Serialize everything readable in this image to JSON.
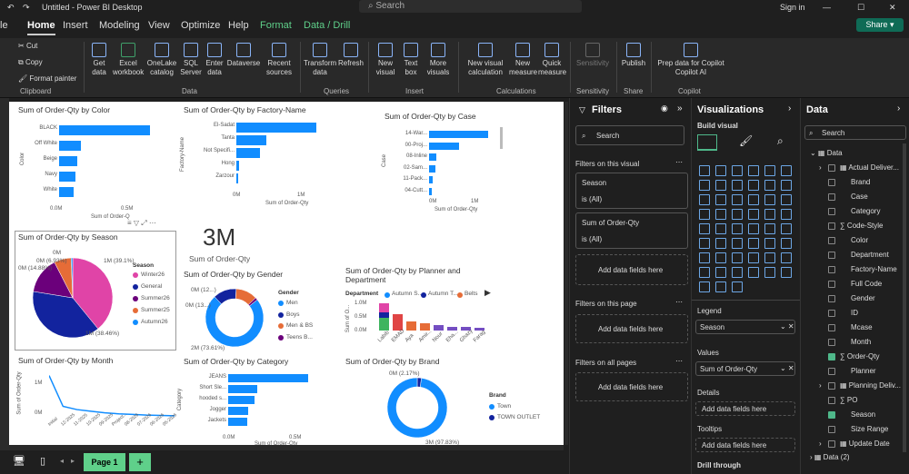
{
  "window": {
    "title": "Untitled - Power BI Desktop",
    "search": "Search",
    "signin": "Sign in"
  },
  "tabs": [
    "Home",
    "Insert",
    "Modeling",
    "View",
    "Optimize",
    "Help",
    "Format",
    "Data / Drill"
  ],
  "share": "Share",
  "ribbon": {
    "clipboard": [
      "Cut",
      "Copy",
      "Format painter"
    ],
    "groups": [
      "Clipboard",
      "Data",
      "Queries",
      "Insert",
      "Calculations",
      "Sensitivity",
      "Share",
      "Copilot"
    ],
    "buttons": [
      "Get data",
      "Excel workbook",
      "OneLake catalog",
      "SQL Server",
      "Enter data",
      "Dataverse",
      "Recent sources",
      "Transform data",
      "Refresh",
      "New visual",
      "Text box",
      "More visuals",
      "New visual calculation",
      "New measure",
      "Quick measure",
      "Sensitivity",
      "Publish",
      "Prep data for Copilot",
      "Copilot AI"
    ]
  },
  "charts": {
    "color": {
      "title": "Sum of Order-Qty by Color",
      "ylabel": "Color",
      "xlabel": "Sum of Order-Q",
      "cats": [
        "BLACK",
        "Off White",
        "Beige",
        "Navy",
        "White"
      ],
      "ticks": [
        "0.0M",
        "0.5M"
      ],
      "chart_data": {
        "type": "bar",
        "categories": [
          "BLACK",
          "Off White",
          "Beige",
          "Navy",
          "White"
        ],
        "values": [
          0.5,
          0.12,
          0.1,
          0.09,
          0.08
        ]
      }
    },
    "factory": {
      "title": "Sum of Order-Qty by Factory-Name",
      "ylabel": "Factory-Name",
      "xlabel": "Sum of Order-Qty",
      "cats": [
        "El-Sadat",
        "Tanta",
        "Not Specifi...",
        "Hong",
        "Zarzour"
      ],
      "ticks": [
        "0M",
        "1M"
      ],
      "chart_data": {
        "type": "bar",
        "categories": [
          "El-Sadat",
          "Tanta",
          "Not Specifi...",
          "Hong",
          "Zarzour"
        ],
        "values": [
          1.0,
          0.38,
          0.3,
          0.03,
          0.02
        ]
      }
    },
    "case": {
      "title": "Sum of Order-Qty by Case",
      "ylabel": "Case",
      "xlabel": "Sum of Order-Qty",
      "cats": [
        "14-War...",
        "00-Proj...",
        "08-Inline",
        "02-Sam...",
        "11-Pack...",
        "04-Cutt..."
      ],
      "ticks": [
        "0M",
        "1M"
      ],
      "chart_data": {
        "type": "bar",
        "categories": [
          "14-War...",
          "00-Proj...",
          "08-Inline",
          "02-Sam...",
          "11-Pack...",
          "04-Cutt..."
        ],
        "values": [
          1.0,
          0.5,
          0.12,
          0.1,
          0.06,
          0.04
        ]
      }
    },
    "card": {
      "value": "3M",
      "label": "Sum of Order-Qty"
    },
    "season": {
      "title": "Sum of Order-Qty by Season",
      "legend_title": "Season",
      "legend": [
        "Winter26",
        "General",
        "Summer26",
        "Summer25",
        "Autumn26"
      ],
      "labels": [
        "1M (39.1%)",
        "1M (38.46%)",
        "0M (14.88%)",
        "0M (6.93%)",
        "0M"
      ],
      "chart_data": {
        "type": "pie",
        "categories": [
          "Winter26",
          "General",
          "Summer26",
          "Summer25",
          "Autumn26"
        ],
        "values": [
          39.1,
          38.46,
          14.88,
          6.93,
          0.63
        ]
      }
    },
    "gender": {
      "title": "Sum of Order-Qty by Gender",
      "legend_title": "Gender",
      "legend": [
        "Men",
        "Boys",
        "Men & BS",
        "Teens B..."
      ],
      "labels": [
        "0M (12...)",
        "0M (13...)",
        "2M (73.61%)"
      ],
      "chart_data": {
        "type": "pie",
        "categories": [
          "Men",
          "Boys",
          "Men & BS",
          "Teens B..."
        ],
        "values": [
          73.61,
          13,
          12,
          1.39
        ]
      }
    },
    "planner": {
      "title": "Sum of Order-Qty by Planner and Department",
      "legend_title": "Department",
      "legend": [
        "Autumn S...",
        "Autumn T...",
        "Belts"
      ],
      "yticks": [
        "1.0M",
        "0.5M",
        "0.0M"
      ],
      "ylabel": "Sum of O...",
      "cats": [
        "Labib",
        "EMAD",
        "Aya",
        "Amir...",
        "Nour",
        "Eha...",
        "Ghazy",
        "Farag"
      ],
      "chart_data": {
        "type": "bar",
        "categories": [
          "Labib",
          "EMAD",
          "Aya",
          "Amir...",
          "Nour",
          "Eha...",
          "Ghazy",
          "Farag"
        ],
        "values": [
          0.75,
          0.6,
          0.35,
          0.28,
          0.2,
          0.15,
          0.12,
          0.1
        ]
      }
    },
    "month": {
      "title": "Sum of Order-Qty by Month",
      "ylabel": "Sum of Order-Qty",
      "yticks": [
        "1M",
        "0M"
      ],
      "cats": [
        "Initial",
        "12-2025",
        "11-2025",
        "10-2025",
        "09-2025",
        "Project...",
        "08-2026",
        "07-2026",
        "06-2026",
        "05-2026"
      ],
      "chart_data": {
        "type": "line",
        "categories": [
          "Initial",
          "12-2025",
          "11-2025",
          "10-2025",
          "09-2025",
          "Project...",
          "08-2026",
          "07-2026",
          "06-2026",
          "05-2026"
        ],
        "values": [
          1.3,
          0.35,
          0.25,
          0.2,
          0.15,
          0.12,
          0.1,
          0.08,
          0.07,
          0.06
        ],
        "ylim": [
          0,
          1.4
        ]
      }
    },
    "category": {
      "title": "Sum of Order-Qty by Category",
      "ylabel": "Category",
      "xlabel": "Sum of Order-Qty",
      "cats": [
        "JEANS",
        "Short Sle...",
        "hooded s...",
        "Jogger",
        "Jackets"
      ],
      "ticks": [
        "0.0M",
        "0.5M"
      ],
      "chart_data": {
        "type": "bar",
        "categories": [
          "JEANS",
          "Short Sle...",
          "hooded s...",
          "Jogger",
          "Jackets"
        ],
        "values": [
          0.6,
          0.22,
          0.2,
          0.15,
          0.14
        ]
      }
    },
    "brand": {
      "title": "Sum of Order-Qty by Brand",
      "legend_title": "Brand",
      "legend": [
        "Town",
        "TOWN OUTLET"
      ],
      "labels": [
        "0M (2.17%)",
        "3M (97.83%)"
      ],
      "chart_data": {
        "type": "pie",
        "categories": [
          "Town",
          "TOWN OUTLET"
        ],
        "values": [
          97.83,
          2.17
        ]
      }
    }
  },
  "filters": {
    "title": "Filters",
    "search": "Search",
    "on_visual": "Filters on this visual",
    "season": "Season",
    "all1": "is (All)",
    "soq": "Sum of Order-Qty",
    "all2": "is (All)",
    "add": "Add data fields here",
    "on_page": "Filters on this page",
    "on_all": "Filters on all pages"
  },
  "viz": {
    "title": "Visualizations",
    "build": "Build visual",
    "legend": "Legend",
    "legend_val": "Season",
    "values": "Values",
    "values_val": "Sum of Order-Qty",
    "details": "Details",
    "add": "Add data fields here",
    "tooltips": "Tooltips",
    "drill": "Drill through"
  },
  "data": {
    "title": "Data",
    "search": "Search",
    "table": "Data",
    "fields": [
      "Actual Deliver...",
      "Brand",
      "Case",
      "Category",
      "Code-Style",
      "Color",
      "Department",
      "Factory-Name",
      "Full Code",
      "Gender",
      "ID",
      "Mcase",
      "Month",
      "Order-Qty",
      "Planner",
      "Planning Deliv...",
      "PO",
      "Season",
      "Size Range",
      "Update Date"
    ],
    "table2": "Data (2)"
  },
  "page": {
    "tab": "Page 1",
    "add": "+"
  }
}
